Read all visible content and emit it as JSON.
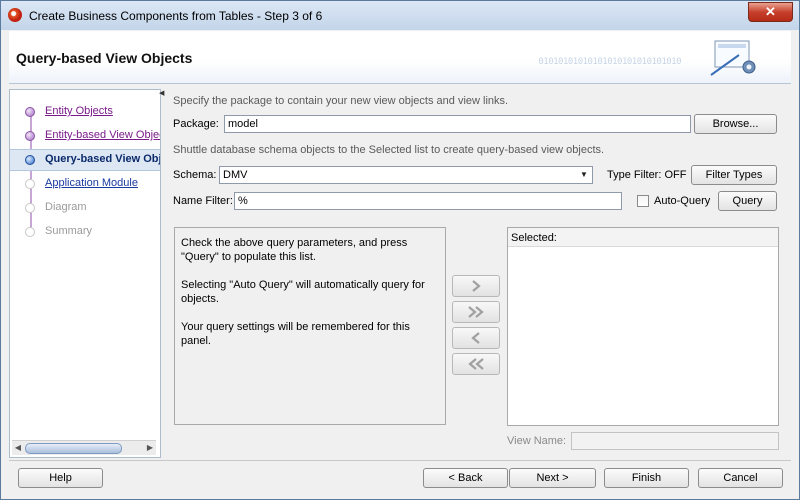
{
  "window": {
    "title": "Create Business Components from Tables - Step 3 of 6",
    "close_glyph": "✕"
  },
  "header": {
    "title": "Query-based View Objects",
    "deco_text": "01010101010101010101010101010"
  },
  "steps": [
    {
      "label": "Entity Objects",
      "state": "visited"
    },
    {
      "label": "Entity-based View Objects",
      "state": "visited"
    },
    {
      "label": "Query-based View Objects",
      "state": "current"
    },
    {
      "label": "Application Module",
      "state": "link"
    },
    {
      "label": "Diagram",
      "state": "todo"
    },
    {
      "label": "Summary",
      "state": "todo"
    }
  ],
  "content": {
    "package_hint": "Specify the package to contain your new view objects and view links.",
    "package_label": "Package:",
    "package_value": "model",
    "browse_button": "Browse...",
    "shuttle_hint": "Shuttle database schema objects to the Selected list to create query-based view objects.",
    "schema_label": "Schema:",
    "schema_value": "DMV",
    "type_filter_text": "Type Filter: OFF",
    "filter_types_button": "Filter Types",
    "name_filter_label": "Name Filter:",
    "name_filter_value": "%",
    "auto_query_label": "Auto-Query",
    "auto_query_checked": false,
    "query_button": "Query",
    "available_messages": [
      "Check the above query parameters, and press \"Query\" to populate this list.",
      "Selecting \"Auto Query\" will automatically query for objects.",
      "Your query settings will be remembered for this panel."
    ],
    "selected_header": "Selected:",
    "view_name_label": "View Name:",
    "view_name_value": ""
  },
  "footer": {
    "help": "Help",
    "back": "< Back",
    "next": "Next >",
    "finish": "Finish",
    "cancel": "Cancel"
  }
}
